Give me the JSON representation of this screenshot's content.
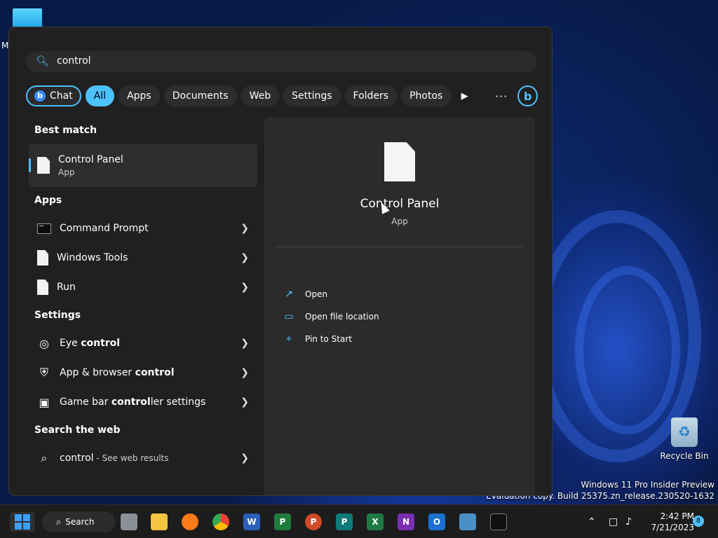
{
  "desktop": {
    "partial_label": "M",
    "recycle_bin_label": "Recycle Bin",
    "watermark_line1": "Windows 11 Pro Insider Preview",
    "watermark_line2": "Evaluation copy. Build 25375.zn_release.230520-1632"
  },
  "search": {
    "query": "control"
  },
  "filters": {
    "chat": "Chat",
    "items": [
      "All",
      "Apps",
      "Documents",
      "Web",
      "Settings",
      "Folders",
      "Photos"
    ],
    "active": "All"
  },
  "results": {
    "best_match_heading": "Best match",
    "best_match": {
      "title": "Control Panel",
      "subtitle": "App"
    },
    "apps_heading": "Apps",
    "apps": [
      {
        "label": "Command Prompt",
        "icon": "command-prompt-icon"
      },
      {
        "label": "Windows Tools",
        "icon": "document-icon"
      },
      {
        "label": "Run",
        "icon": "document-icon"
      }
    ],
    "settings_heading": "Settings",
    "settings": [
      {
        "label_pre": "Eye ",
        "label_bold": "control",
        "label_post": "",
        "icon": "eye-control-icon"
      },
      {
        "label_pre": "App & browser ",
        "label_bold": "control",
        "label_post": "",
        "icon": "shield-icon"
      },
      {
        "label_pre": "Game bar ",
        "label_bold": "control",
        "label_post": "ler settings",
        "icon": "game-bar-icon"
      }
    ],
    "web_heading": "Search the web",
    "web": {
      "query": "control",
      "suffix": " - See web results"
    }
  },
  "preview": {
    "title": "Control Panel",
    "subtitle": "App",
    "actions": [
      {
        "label": "Open",
        "icon": "open-external-icon"
      },
      {
        "label": "Open file location",
        "icon": "folder-icon"
      },
      {
        "label": "Pin to Start",
        "icon": "pin-icon"
      }
    ]
  },
  "taskbar": {
    "search_label": "Search",
    "apps": [
      {
        "name": "task-view",
        "glyph": "",
        "color": "#9aa0a6"
      },
      {
        "name": "file-explorer",
        "glyph": "",
        "color": "#f4c542"
      },
      {
        "name": "firefox",
        "glyph": "",
        "color": "#ff7a1a"
      },
      {
        "name": "chrome",
        "glyph": "",
        "color": "#34a853"
      },
      {
        "name": "word",
        "glyph": "W",
        "color": "#2b5fb8"
      },
      {
        "name": "project",
        "glyph": "P",
        "color": "#1f7a3e"
      },
      {
        "name": "powerpoint",
        "glyph": "P",
        "color": "#d04a27"
      },
      {
        "name": "publisher",
        "glyph": "P",
        "color": "#0f7a7a"
      },
      {
        "name": "excel",
        "glyph": "X",
        "color": "#1e7a44"
      },
      {
        "name": "onenote",
        "glyph": "N",
        "color": "#7a2fb0"
      },
      {
        "name": "outlook",
        "glyph": "O",
        "color": "#1a6fd0"
      },
      {
        "name": "touch-keyboard",
        "glyph": "",
        "color": "#4a90c8"
      },
      {
        "name": "terminal",
        "glyph": "",
        "color": "#101010"
      }
    ],
    "time": "2:42 PM",
    "date": "7/21/2023",
    "notifications": "8"
  }
}
